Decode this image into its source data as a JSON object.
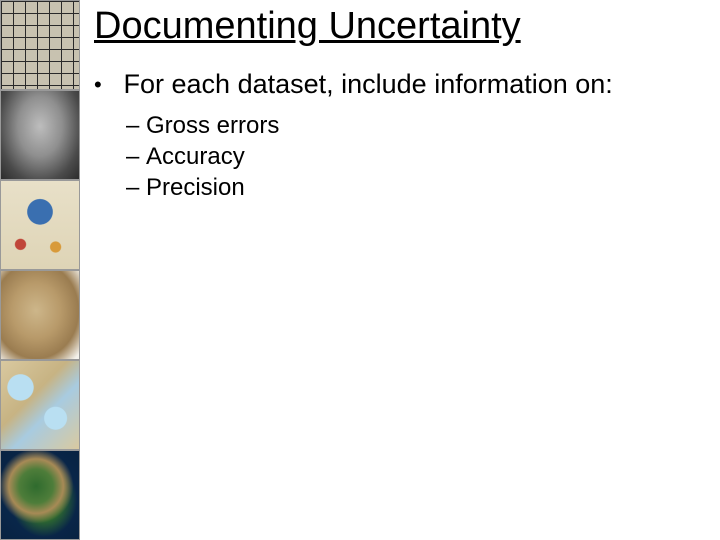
{
  "title": "Documenting Uncertainty",
  "bullet1": "For each dataset, include information on:",
  "sub": {
    "a": "Gross errors",
    "b": "Accuracy",
    "c": "Precision"
  },
  "thumbs": {
    "t1": "geometric-grid-map",
    "t2": "clay-tablet-map",
    "t3": "medieval-world-map",
    "t4": "parchment-fragment-map",
    "t5": "atlas-relief-map",
    "t6": "satellite-continent-map"
  }
}
